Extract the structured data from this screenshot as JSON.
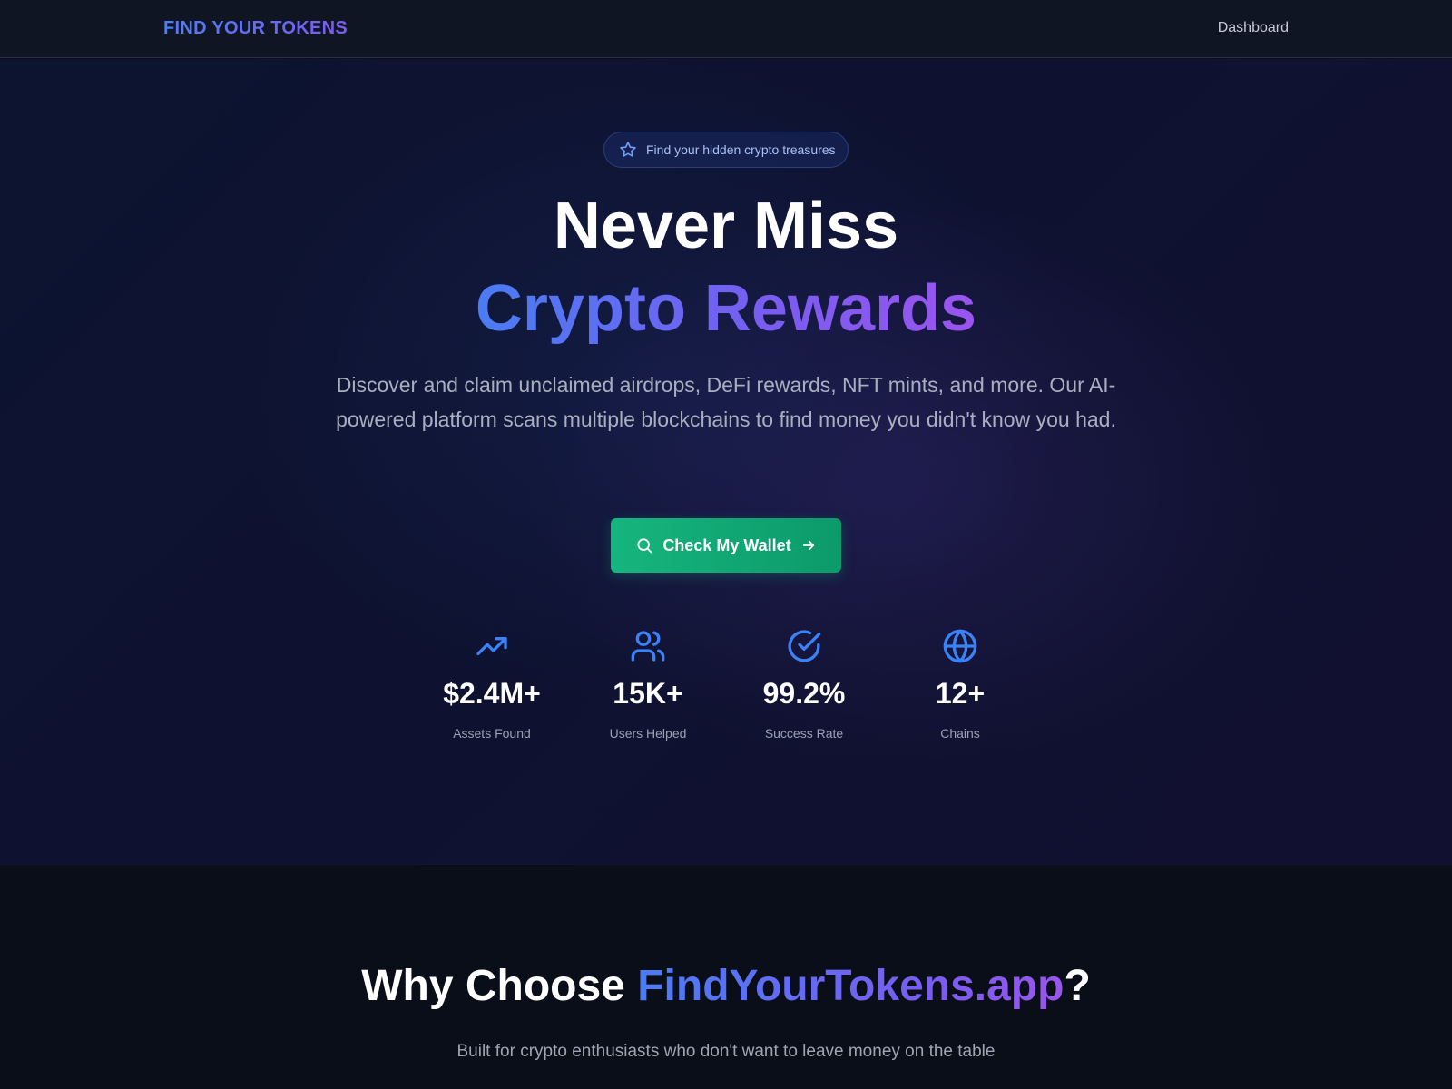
{
  "nav": {
    "brand": "FIND YOUR TOKENS",
    "links": [
      {
        "label": "Dashboard"
      }
    ]
  },
  "hero": {
    "badge": {
      "icon": "star-icon",
      "text": "Find your hidden crypto treasures"
    },
    "headline_line1": "Never Miss",
    "headline_line2": "Crypto Rewards",
    "description": "Discover and claim unclaimed airdrops, DeFi rewards, NFT mints, and more. Our AI-powered platform scans multiple blockchains to find money you didn't know you had.",
    "cta": {
      "label": "Check My Wallet",
      "icon_left": "search-icon",
      "icon_right": "arrow-right-icon"
    },
    "stats": [
      {
        "icon": "trending-up-icon",
        "value": "$2.4M+",
        "label": "Assets Found"
      },
      {
        "icon": "users-icon",
        "value": "15K+",
        "label": "Users Helped"
      },
      {
        "icon": "check-circle-icon",
        "value": "99.2%",
        "label": "Success Rate"
      },
      {
        "icon": "globe-icon",
        "value": "12+",
        "label": "Chains"
      }
    ]
  },
  "why": {
    "title_prefix": "Why Choose ",
    "title_brand": "FindYourTokens.app",
    "title_suffix": "?",
    "description": "Built for crypto enthusiasts who don't want to leave money on the table"
  },
  "colors": {
    "accent_blue": "#4a7cf3",
    "accent_purple": "#7a5cf0",
    "cta_green": "#16b57e",
    "icon_blue": "#3b82f6",
    "background": "#0a0e1a"
  }
}
